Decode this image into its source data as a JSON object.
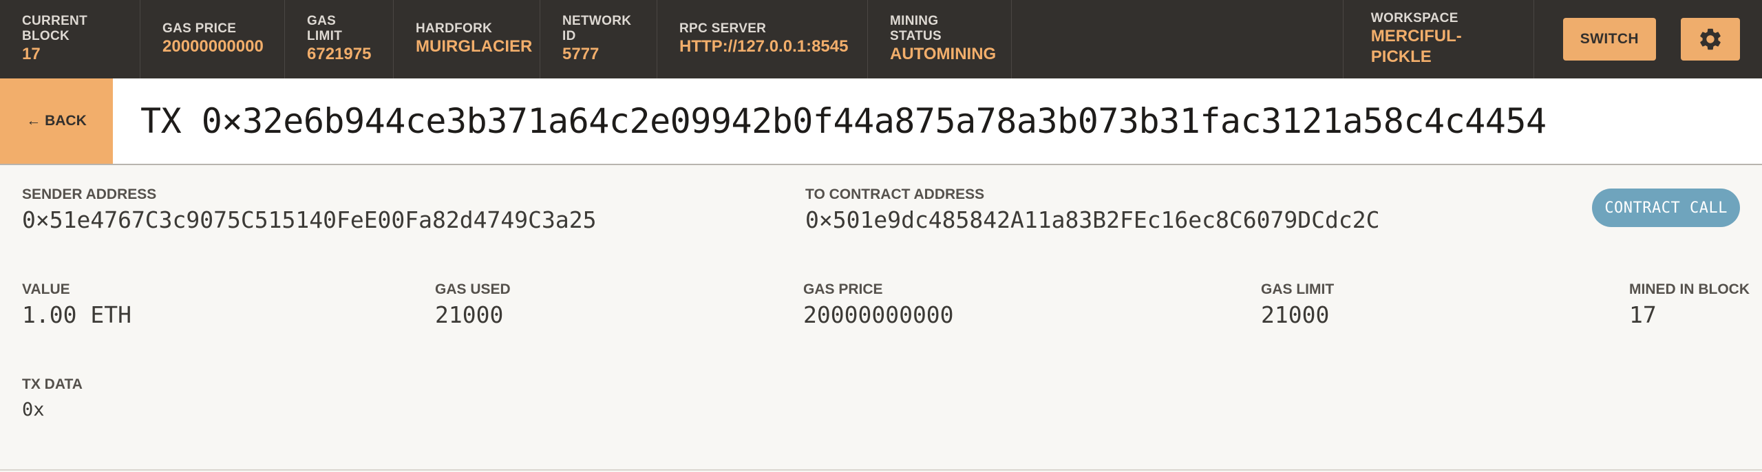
{
  "status_bar": {
    "current_block": {
      "label": "CURRENT BLOCK",
      "value": "17"
    },
    "gas_price": {
      "label": "GAS PRICE",
      "value": "20000000000"
    },
    "gas_limit": {
      "label": "GAS LIMIT",
      "value": "6721975"
    },
    "hardfork": {
      "label": "HARDFORK",
      "value": "MUIRGLACIER"
    },
    "network_id": {
      "label": "NETWORK ID",
      "value": "5777"
    },
    "rpc_server": {
      "label": "RPC SERVER",
      "value": "HTTP://127.0.0.1:8545"
    },
    "mining_status": {
      "label": "MINING STATUS",
      "value": "AUTOMINING"
    },
    "workspace": {
      "label": "WORKSPACE",
      "value": "MERCIFUL-PICKLE"
    },
    "switch_label": "SWITCH",
    "settings_icon": "gear-icon"
  },
  "title_bar": {
    "back_label": "← BACK",
    "title": "TX 0×32e6b944ce3b371a64c2e09942b0f44a875a78a3b073b31fac3121a58c4c4454"
  },
  "details": {
    "sender": {
      "label": "SENDER ADDRESS",
      "value": "0×51e4767C3c9075C515140FeE00Fa82d4749C3a25"
    },
    "to_contract": {
      "label": "TO CONTRACT ADDRESS",
      "value": "0×501e9dc485842A11a83B2FEc16ec8C6079DCdc2C"
    },
    "badge": "CONTRACT CALL",
    "value": {
      "label": "VALUE",
      "value": "1.00 ETH"
    },
    "gas_used": {
      "label": "GAS USED",
      "value": "21000"
    },
    "gas_price": {
      "label": "GAS PRICE",
      "value": "20000000000"
    },
    "gas_limit": {
      "label": "GAS LIMIT",
      "value": "21000"
    },
    "mined_in_block": {
      "label": "MINED IN BLOCK",
      "value": "17"
    },
    "tx_data": {
      "label": "TX DATA",
      "value": "0x"
    }
  },
  "colors": {
    "topbar_bg": "#33302d",
    "accent": "#f2ae6b",
    "badge": "#6fa4bd",
    "page_bg": "#f8f7f4"
  }
}
